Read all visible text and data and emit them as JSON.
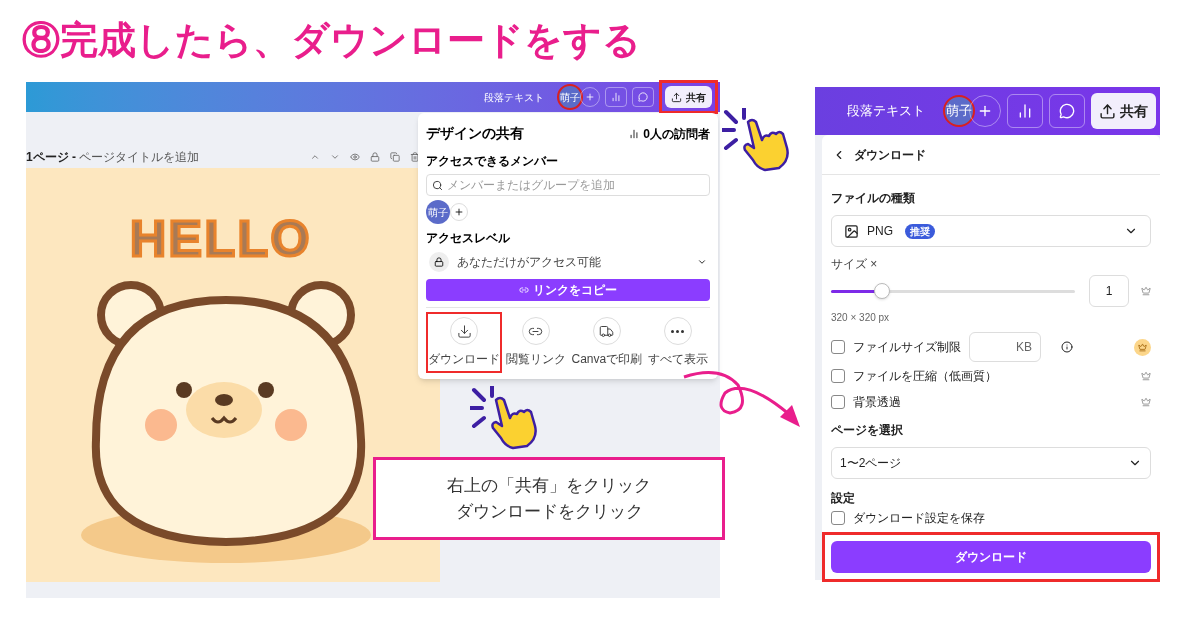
{
  "heading": "⑧完成したら、ダウンロードをする",
  "left_screen": {
    "topbar": {
      "label": "段落テキスト",
      "avatar": "萌子",
      "share": "共有",
      "share_highlighted": true
    },
    "page_number": "1ページ - ",
    "page_title_placeholder": "ページタイトルを追加",
    "artwork_text": "HELLO",
    "share_panel": {
      "title": "デザインの共有",
      "visitors": "0人の訪問者",
      "members_label": "アクセスできるメンバー",
      "search_placeholder": "メンバーまたはグループを追加",
      "member": "萌子",
      "access_label": "アクセスレベル",
      "access_value": "あなただけがアクセス可能",
      "copy_link": "リンクをコピー",
      "actions": [
        {
          "kind": "download",
          "label": "ダウンロード",
          "highlighted": true
        },
        {
          "kind": "link",
          "label": "閲覧リンク",
          "highlighted": false
        },
        {
          "kind": "print",
          "label": "Canvaで印刷",
          "highlighted": false
        },
        {
          "kind": "more",
          "label": "すべて表示",
          "highlighted": false
        }
      ]
    }
  },
  "right_screen": {
    "topbar": {
      "label": "段落テキスト",
      "avatar": "萌子",
      "share": "共有"
    },
    "panel": {
      "title": "ダウンロード",
      "file_type_label": "ファイルの種類",
      "file_type": "PNG",
      "badge": "推奨",
      "size_label": "サイズ ×",
      "size": {
        "level": 0.21,
        "value": "1"
      },
      "dimensions": "320 × 320 px",
      "options": [
        {
          "kind": "size_limit",
          "label": "ファイルサイズ制限",
          "unit": "KB",
          "checked": false
        },
        {
          "kind": "plain",
          "label": "ファイルを圧縮（低画質）",
          "checked": false
        },
        {
          "kind": "plain",
          "label": "背景透過",
          "checked": false
        }
      ],
      "pages_label": "ページを選択",
      "pages": "1〜2ページ",
      "settings_label": "設定",
      "save_setting": {
        "label": "ダウンロード設定を保存",
        "checked": false
      },
      "download": "ダウンロード",
      "download_highlighted": true
    }
  },
  "callout": [
    "右上の「共有」をクリック",
    "ダウンロードをクリック"
  ]
}
